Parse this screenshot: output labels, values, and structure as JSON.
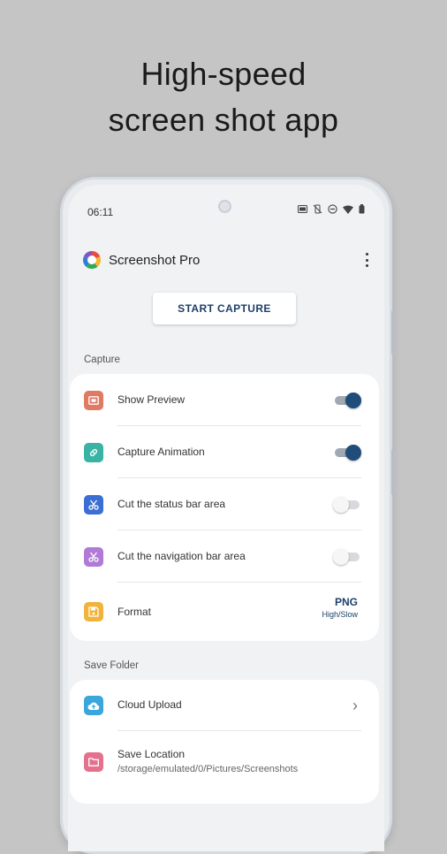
{
  "headline": {
    "line1": "High-speed",
    "line2": "screen shot app"
  },
  "status_bar": {
    "time": "06:11",
    "icons": [
      "cast-icon",
      "vibrate-off-icon",
      "dnd-icon",
      "wifi-icon",
      "battery-icon"
    ]
  },
  "app_bar": {
    "title": "Screenshot Pro",
    "menu_icon": "more-vert-icon"
  },
  "capture_button": {
    "label": "START CAPTURE"
  },
  "capture_section": {
    "header": "Capture",
    "items": [
      {
        "label": "Show Preview",
        "icon": "preview-icon",
        "icon_color": "#e07a63",
        "toggle_on": true
      },
      {
        "label": "Capture Animation",
        "icon": "animation-icon",
        "icon_color": "#38b3a4",
        "toggle_on": true
      },
      {
        "label": "Cut the status bar area",
        "icon": "scissors-icon",
        "icon_color": "#3b6fd4",
        "toggle_on": false
      },
      {
        "label": "Cut the navigation bar area",
        "icon": "scissors-icon",
        "icon_color": "#b07ad6",
        "toggle_on": false
      },
      {
        "label": "Format",
        "icon": "save-icon",
        "icon_color": "#f2b33d",
        "value": "PNG",
        "value_sub": "High/Slow"
      }
    ]
  },
  "save_section": {
    "header": "Save Folder",
    "items": [
      {
        "label": "Cloud Upload",
        "icon": "cloud-upload-icon",
        "icon_color": "#3aa6dc"
      },
      {
        "label": "Save Location",
        "icon": "folder-icon",
        "icon_color": "#e4728e",
        "sub": "/storage/emulated/0/Pictures/Screenshots"
      }
    ]
  },
  "colors": {
    "accent": "#1f4c78",
    "background": "#c5c5c5"
  }
}
